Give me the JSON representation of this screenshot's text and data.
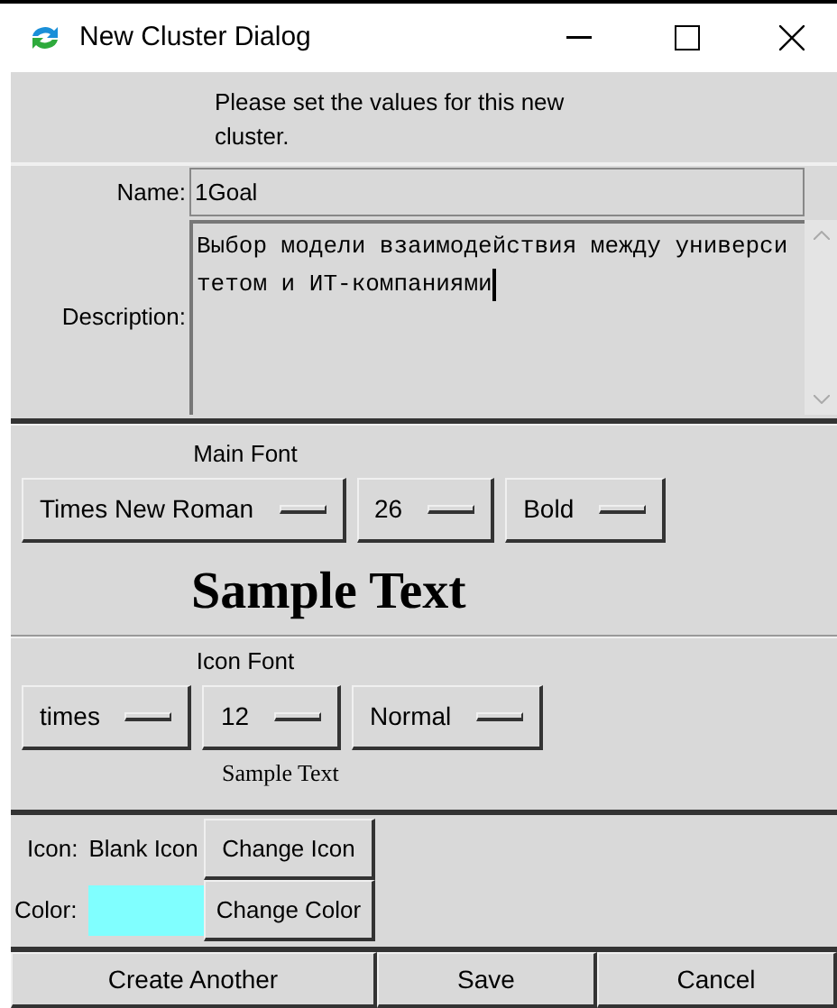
{
  "window": {
    "title": "New Cluster Dialog"
  },
  "intro": "Please set the values for this new cluster.",
  "name": {
    "label": "Name:",
    "value": "1Goal"
  },
  "description": {
    "label": "Description:",
    "value": "Выбор модели взаимодействия между университетом и ИТ-компаниями"
  },
  "main_font": {
    "title": "Main Font",
    "family": "Times New Roman",
    "size": "26",
    "weight": "Bold",
    "sample": "Sample Text"
  },
  "icon_font": {
    "title": "Icon Font",
    "family": "times",
    "size": "12",
    "weight": "Normal",
    "sample": "Sample Text"
  },
  "icon": {
    "label": "Icon:",
    "value": "Blank Icon",
    "button": "Change Icon"
  },
  "color": {
    "label": "Color:",
    "color": "#80ffff",
    "button": "Change Color"
  },
  "buttons": [
    "Create Another",
    "Save",
    "Cancel"
  ]
}
